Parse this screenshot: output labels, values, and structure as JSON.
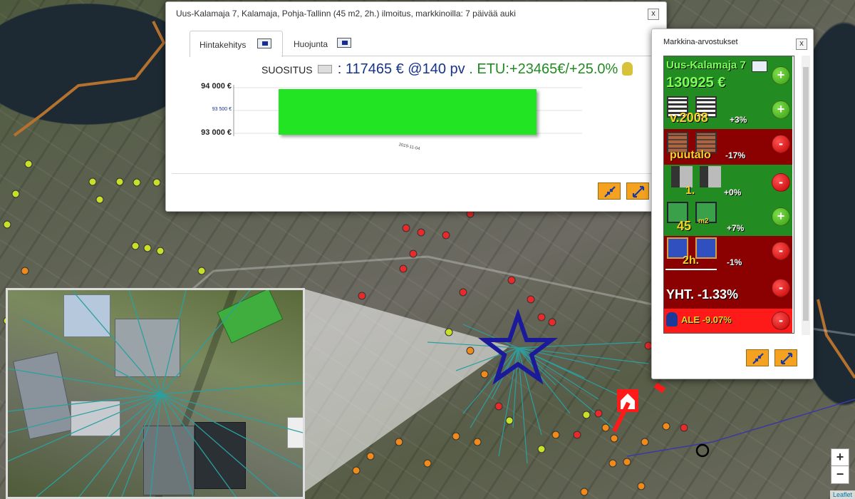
{
  "popup": {
    "title": "Uus-Kalamaja 7, Kalamaja, Pohja-Tallinn (45 m2, 2h.) ilmoitus, markkinoilla: 7 päivää auki",
    "close": "x",
    "tabs": [
      {
        "label": "Hintakehitys"
      },
      {
        "label": "Huojunta"
      }
    ],
    "summary": {
      "prefix": "SUOSITUS",
      "value": ": 117465 € @140 pv",
      "sep": ".",
      "etu": "ETU:+23465€/+25.0%"
    }
  },
  "chart_data": {
    "type": "bar",
    "categories": [
      "2019-11-04"
    ],
    "values": [
      94000
    ],
    "ylim": [
      93000,
      94000
    ],
    "yticks": [
      "94 000 €",
      "93 500 €",
      "93 000 €"
    ],
    "bar_color": "#22e422"
  },
  "market": {
    "title": "Markkina-arvostukset",
    "close": "x",
    "address": "Uus-Kalamaja 7",
    "price": "130925 €",
    "rows": [
      {
        "label": "v.2008",
        "pct": "+3%",
        "type": "plus"
      },
      {
        "label": "puutalo",
        "pct": "-17%",
        "type": "minus"
      },
      {
        "label": "1.",
        "pct": "+0%",
        "type": "minus"
      },
      {
        "label": "45",
        "unit": "m2",
        "pct": "+7%",
        "type": "plus"
      },
      {
        "label": "2h.",
        "pct": "-1%",
        "type": "minus"
      }
    ],
    "total": "YHT. -1.33%",
    "ale": "ALE -9.07%"
  },
  "map": {
    "zoom_in": "+",
    "zoom_out": "−",
    "attribution": "Leaflet"
  },
  "colors": {
    "accent_orange": "#f4a21f",
    "plus_green": "#228b22",
    "minus_red": "#8b0000",
    "ale_red": "#ff1a1a",
    "star_blue": "#1a1a9a"
  }
}
